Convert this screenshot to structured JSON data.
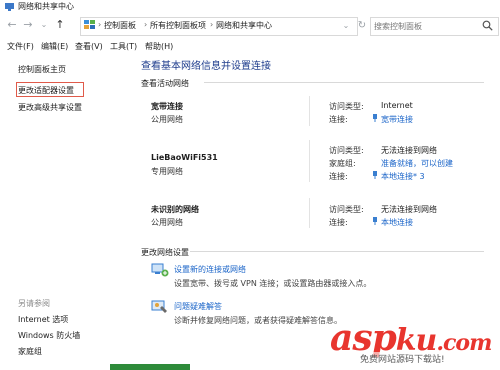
{
  "window": {
    "title": "网络和共享中心"
  },
  "address": {
    "crumbs": [
      "控制面板",
      "所有控制面板项",
      "网络和共享中心"
    ],
    "search_placeholder": "搜索控制面板"
  },
  "menu": {
    "items": [
      "文件(F)",
      "编辑(E)",
      "查看(V)",
      "工具(T)",
      "帮助(H)"
    ]
  },
  "left": {
    "links": [
      "控制面板主页",
      "更改适配器设置",
      "更改高级共享设置"
    ],
    "see_also_label": "另请参阅",
    "see_also": [
      "Internet 选项",
      "Windows 防火墙",
      "家庭组"
    ]
  },
  "main": {
    "title": "查看基本网络信息并设置连接",
    "active_label": "查看活动网络",
    "networks": [
      {
        "name": "宽带连接",
        "type": "公用网络",
        "access_label": "访问类型:",
        "access_value": "Internet",
        "conn_label": "连接:",
        "conn_value": "宽带连接"
      },
      {
        "name": "LieBaoWiFi531",
        "type": "专用网络",
        "access_label": "访问类型:",
        "access_value": "无法连接到网络",
        "home_label": "家庭组:",
        "home_value": "准备就绪，可以创建",
        "conn_label": "连接:",
        "conn_value": "本地连接* 3"
      },
      {
        "name": "未识别的网络",
        "type": "公用网络",
        "access_label": "访问类型:",
        "access_value": "无法连接到网络",
        "conn_label": "连接:",
        "conn_value": "本地连接"
      }
    ],
    "change_label": "更改网络设置",
    "tasks": [
      {
        "title": "设置新的连接或网络",
        "desc": "设置宽带、拨号或 VPN 连接；或设置路由器或接入点。"
      },
      {
        "title": "问题疑难解答",
        "desc": "诊断并修复网络问题，或者获得疑难解答信息。"
      }
    ]
  },
  "watermark": {
    "logo": "aspku.com",
    "caption": "免费网站源码下载站!"
  },
  "colors": {
    "link": "#1a64c8",
    "title": "#1e3c8c",
    "highlight": "#e05a4a",
    "watermark": "#e8352e"
  }
}
